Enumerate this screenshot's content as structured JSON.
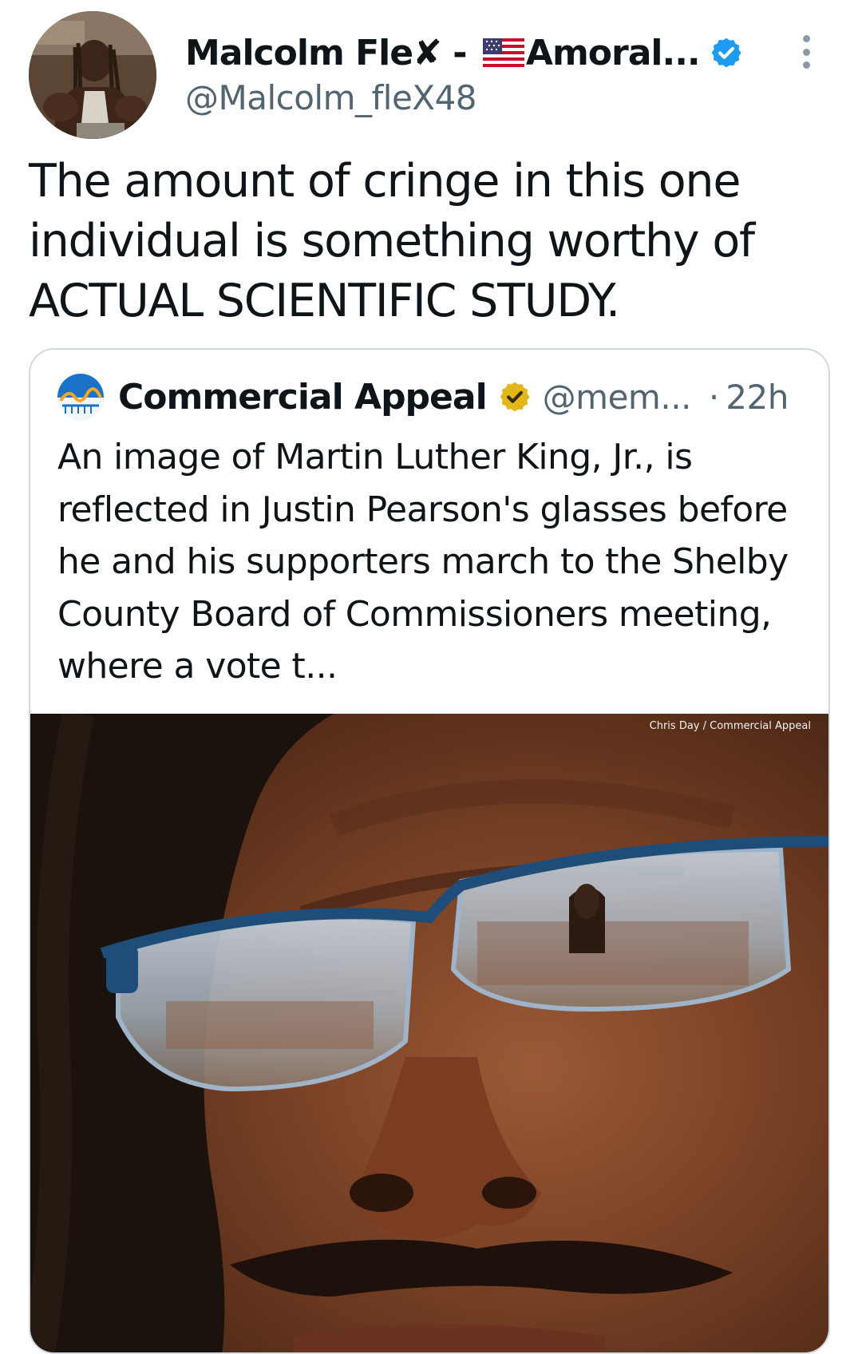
{
  "author": {
    "display_name": "Malcolm Fle",
    "display_name_x": "✘",
    "display_name_dash": " - ",
    "display_name_suffix": "Amoral...",
    "flag_icon": "us-flag-icon",
    "handle": "@Malcolm_fleX48",
    "verified_color": "#1d9bf0"
  },
  "tweet": {
    "text": "The amount of cringe in this one individual is something worthy of ACTUAL SCIENTIFIC STUDY."
  },
  "quote": {
    "name": "Commercial Appeal",
    "handle": "@mem...",
    "separator": "·",
    "time": "22h",
    "verified_color": "#e2b719",
    "text": "An image of Martin Luther King, Jr., is reflected in Justin Pearson's glasses before he and his supporters march to the Shelby County Board of Commissioners meeting, where a vote t...",
    "photo_credit": "Chris Day / Commercial Appeal"
  },
  "icons": {
    "more": "more-options-icon",
    "verified": "verified-badge-icon"
  }
}
